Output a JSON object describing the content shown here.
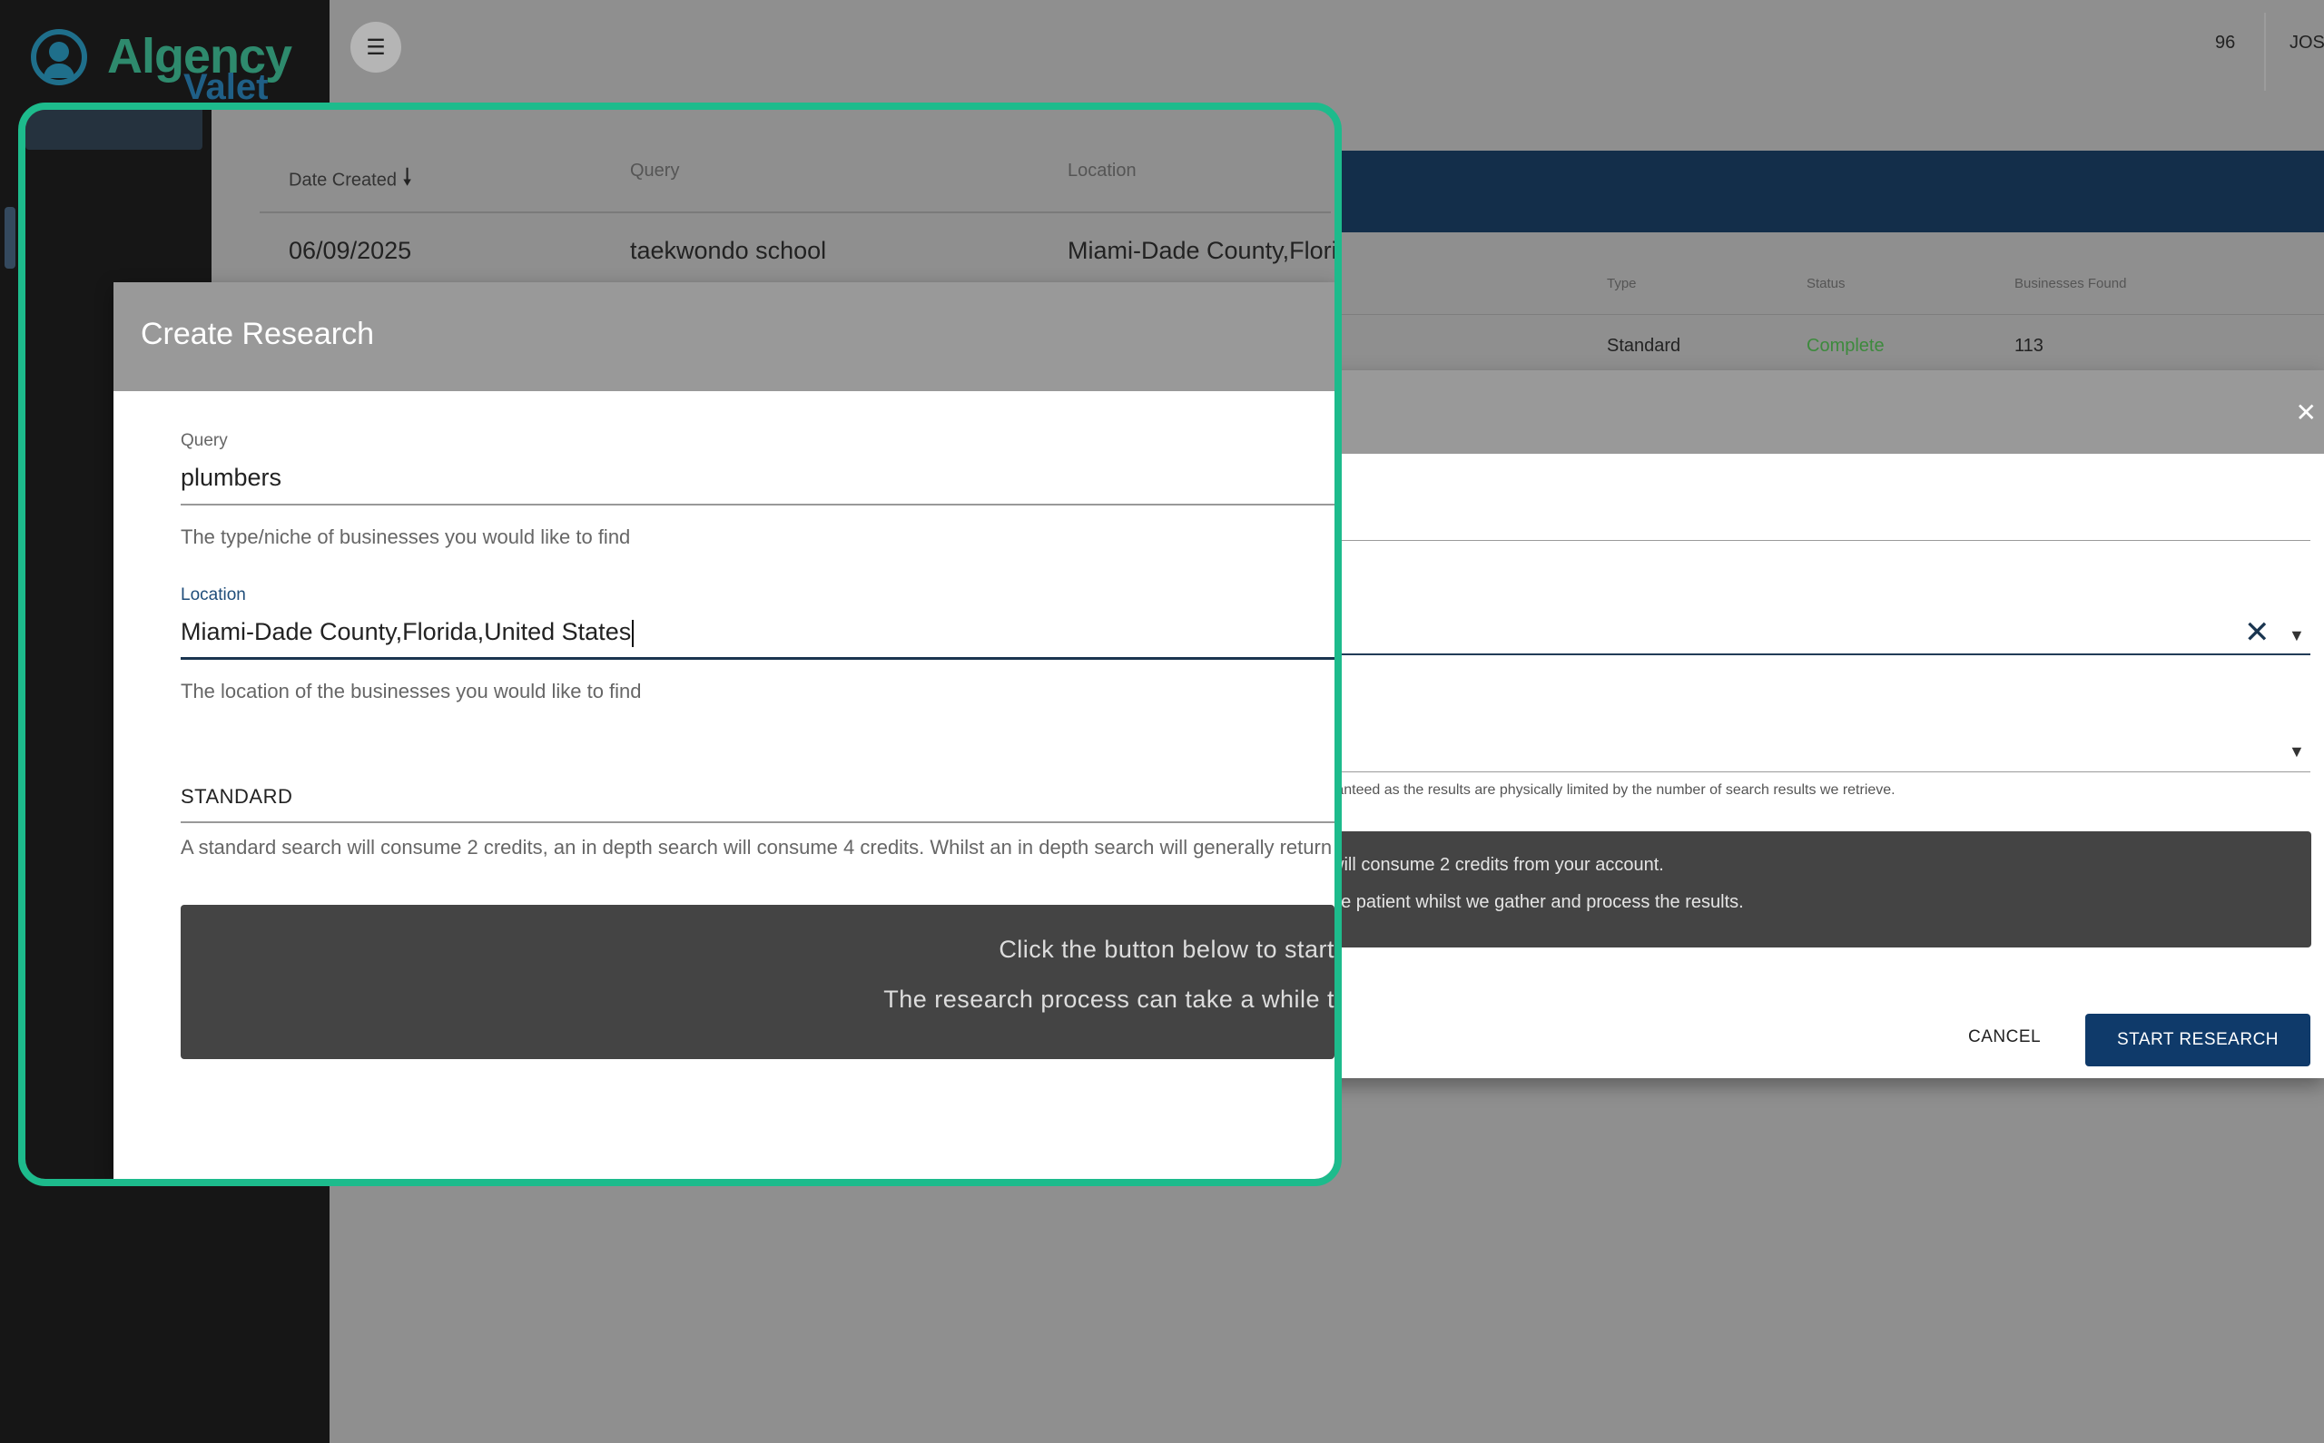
{
  "brand": {
    "name_line1": "Algency",
    "name_line2": "Valet"
  },
  "topbar": {
    "menu_icon": "menu-icon",
    "credits": "96",
    "user": "JOS"
  },
  "background_table": {
    "headers": [
      "Type",
      "Status",
      "Businesses Found"
    ],
    "row": {
      "type": "Standard",
      "status": "Complete",
      "businesses_found": "113"
    }
  },
  "bg_modal": {
    "hint_partial": "ranteed as the results are physically limited by the number of search results we retrieve.",
    "dark_line1_partial": "will consume 2 credits from your account.",
    "dark_line2_partial": "be patient whilst we gather and process the results.",
    "cancel_label": "CANCEL",
    "start_label": "START RESEARCH"
  },
  "zoom": {
    "table": {
      "headers": [
        "Date Created",
        "Query",
        "Location"
      ],
      "row": {
        "date": "06/09/2025",
        "query": "taekwondo school",
        "location": "Miami-Dade County,Floric"
      }
    },
    "modal": {
      "title": "Create Research",
      "query_label": "Query",
      "query_value": "plumbers",
      "query_help": "The type/niche of businesses you would like to find",
      "location_label": "Location",
      "location_value": "Miami-Dade County,Florida,United States",
      "location_help": "The location of the businesses you would like to find",
      "type_value": "STANDARD",
      "type_help": "A standard search will consume 2 credits, an in depth search will consume 4 credits. Whilst an in depth search will generally return",
      "info_line1": "Click the button below to start",
      "info_line2": "The research process can take a while t"
    }
  },
  "colors": {
    "accent_green": "#1dbb8c",
    "primary_blue": "#0f3a6a",
    "status_complete": "#3d8a3d"
  }
}
